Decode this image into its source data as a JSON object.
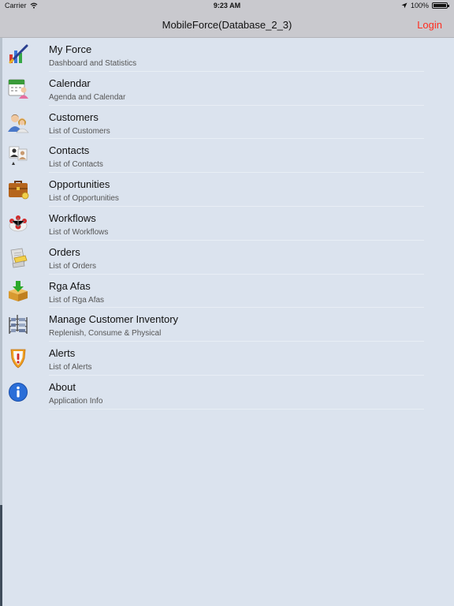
{
  "status_bar": {
    "carrier": "Carrier",
    "time": "9:23 AM",
    "battery": "100%"
  },
  "nav_bar": {
    "title": "MobileForce(Database_2_3)",
    "login_label": "Login"
  },
  "menu": {
    "items": [
      {
        "title": "My Force",
        "subtitle": "Dashboard and Statistics",
        "icon": "dashboard-chart-icon"
      },
      {
        "title": "Calendar",
        "subtitle": "Agenda and Calendar",
        "icon": "calendar-icon"
      },
      {
        "title": "Customers",
        "subtitle": "List of Customers",
        "icon": "customers-icon"
      },
      {
        "title": "Contacts",
        "subtitle": "List of Contacts",
        "icon": "contacts-icon"
      },
      {
        "title": "Opportunities",
        "subtitle": "List of Opportunities",
        "icon": "briefcase-icon"
      },
      {
        "title": "Workflows",
        "subtitle": "List of Workflows",
        "icon": "workflow-icon"
      },
      {
        "title": "Orders",
        "subtitle": "List of Orders",
        "icon": "orders-icon"
      },
      {
        "title": "Rga Afas",
        "subtitle": "List of Rga Afas",
        "icon": "return-box-icon"
      },
      {
        "title": "Manage Customer Inventory",
        "subtitle": "Replenish, Consume & Physical",
        "icon": "inventory-shelf-icon"
      },
      {
        "title": "Alerts",
        "subtitle": "List of Alerts",
        "icon": "alert-icon"
      },
      {
        "title": "About",
        "subtitle": "Application Info",
        "icon": "info-icon"
      }
    ]
  }
}
